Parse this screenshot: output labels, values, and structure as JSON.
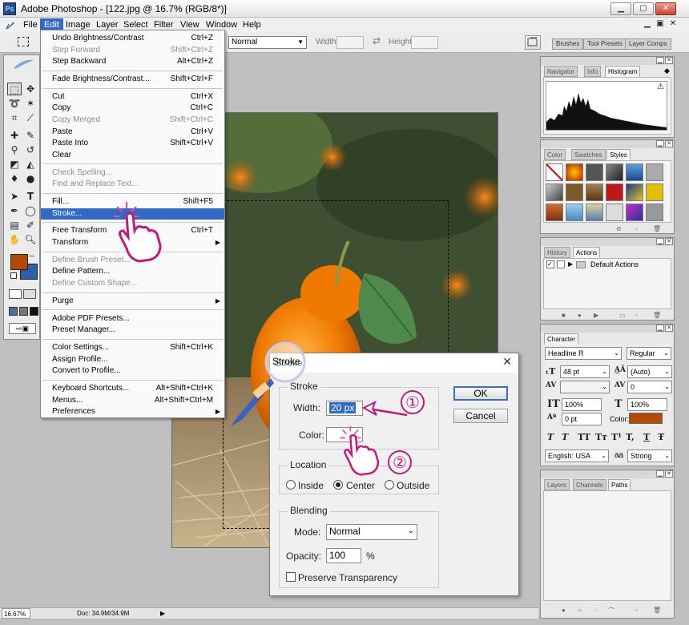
{
  "window": {
    "title": "Adobe Photoshop - [122.jpg @ 16.7% (RGB/8*)]",
    "app_icon": "Ps"
  },
  "menubar": {
    "items": [
      {
        "label": "File"
      },
      {
        "label": "Edit"
      },
      {
        "label": "Image"
      },
      {
        "label": "Layer"
      },
      {
        "label": "Select"
      },
      {
        "label": "Filter"
      },
      {
        "label": "View"
      },
      {
        "label": "Window"
      },
      {
        "label": "Help"
      }
    ],
    "active": "Edit"
  },
  "options_bar": {
    "style_value": "Normal",
    "width_label": "Width:",
    "height_label": "Height:"
  },
  "well_tabs": [
    "Brushes",
    "Tool Presets",
    "Layer Comps"
  ],
  "edit_menu": {
    "items": [
      {
        "label": "Undo Brightness/Contrast",
        "shortcut": "Ctrl+Z"
      },
      {
        "label": "Step Forward",
        "shortcut": "Shift+Ctrl+Z",
        "disabled": true
      },
      {
        "label": "Step Backward",
        "shortcut": "Alt+Ctrl+Z"
      },
      {
        "label": "Fade Brightness/Contrast...",
        "shortcut": "Shift+Ctrl+F"
      },
      {
        "label": "Cut",
        "shortcut": "Ctrl+X"
      },
      {
        "label": "Copy",
        "shortcut": "Ctrl+C"
      },
      {
        "label": "Copy Merged",
        "shortcut": "Shift+Ctrl+C",
        "disabled": true
      },
      {
        "label": "Paste",
        "shortcut": "Ctrl+V"
      },
      {
        "label": "Paste Into",
        "shortcut": "Shift+Ctrl+V"
      },
      {
        "label": "Clear",
        "shortcut": ""
      },
      {
        "label": "Check Spelling...",
        "shortcut": "",
        "disabled": true
      },
      {
        "label": "Find and Replace Text...",
        "shortcut": "",
        "disabled": true
      },
      {
        "label": "Fill...",
        "shortcut": "Shift+F5"
      },
      {
        "label": "Stroke...",
        "shortcut": "",
        "highlighted": true
      },
      {
        "label": "Free Transform",
        "shortcut": "Ctrl+T"
      },
      {
        "label": "Transform",
        "shortcut": "",
        "submenu": true
      },
      {
        "label": "Define Brush Preset...",
        "shortcut": "",
        "disabled": true
      },
      {
        "label": "Define Pattern...",
        "shortcut": ""
      },
      {
        "label": "Define Custom Shape...",
        "shortcut": "",
        "disabled": true
      },
      {
        "label": "Purge",
        "shortcut": "",
        "submenu": true
      },
      {
        "label": "Adobe PDF Presets...",
        "shortcut": ""
      },
      {
        "label": "Preset Manager...",
        "shortcut": ""
      },
      {
        "label": "Color Settings...",
        "shortcut": "Shift+Ctrl+K"
      },
      {
        "label": "Assign Profile...",
        "shortcut": ""
      },
      {
        "label": "Convert to Profile...",
        "shortcut": ""
      },
      {
        "label": "Keyboard Shortcuts...",
        "shortcut": "Alt+Shift+Ctrl+K"
      },
      {
        "label": "Menus...",
        "shortcut": "Alt+Shift+Ctrl+M"
      },
      {
        "label": "Preferences",
        "shortcut": "",
        "submenu": true
      }
    ]
  },
  "palettes": {
    "navigator": {
      "tabs": [
        "Navigator",
        "Info",
        "Histogram"
      ],
      "active": "Histogram",
      "warning": "⚠"
    },
    "styles": {
      "tabs": [
        "Color",
        "Swatches",
        "Styles"
      ],
      "active": "Styles"
    },
    "actions": {
      "tabs": [
        "History",
        "Actions"
      ],
      "active": "Actions",
      "row_label": "Default Actions"
    },
    "character": {
      "tabs": [
        "Character"
      ],
      "font_family": "Headline R",
      "font_style": "Regular",
      "size": "48 pt",
      "leading": "(Auto)",
      "tracking": "0",
      "vertical_scale": "100%",
      "horizontal_scale": "100%",
      "baseline_shift": "0 pt",
      "color_label": "Color:",
      "text_color": "#b34a00",
      "style_buttons": [
        "T",
        "T",
        "TT",
        "Tт",
        "T¹",
        "T,",
        "T",
        "Ŧ"
      ],
      "language": "English: USA",
      "antialias_icon": "aa",
      "antialias": "Strong"
    },
    "layers": {
      "tabs": [
        "Layers",
        "Channels",
        "Paths"
      ],
      "active": "Paths"
    }
  },
  "status_bar": {
    "zoom": "16.67%",
    "doc": "Doc: 34.9M/34.9M"
  },
  "colors": {
    "foreground": "#b34a00",
    "background": "#2b5fa8",
    "menu_highlight": "#316ac5",
    "annotation": "#c4187e"
  },
  "stroke_dialog": {
    "title": "Stroke",
    "close": "✕",
    "stroke_group": "Stroke",
    "width_label": "Width:",
    "width_value": "20 px",
    "color_label": "Color:",
    "location_group": "Location",
    "location_options": [
      "Inside",
      "Center",
      "Outside"
    ],
    "location_selected": "Center",
    "blending_group": "Blending",
    "mode_label": "Mode:",
    "mode_value": "Normal",
    "opacity_label": "Opacity:",
    "opacity_value": "100",
    "opacity_unit": "%",
    "preserve_label": "Preserve Transparency",
    "ok_label": "OK",
    "cancel_label": "Cancel"
  },
  "annotations": {
    "callout_title": "Stroke",
    "step1": "①",
    "step2": "②"
  }
}
